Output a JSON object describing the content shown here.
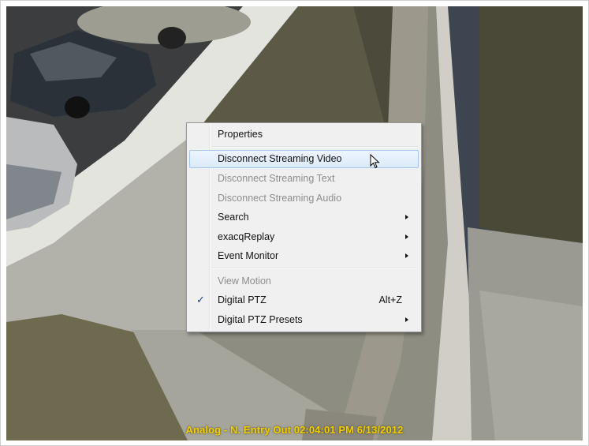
{
  "camera_overlay": "Analog - N. Entry Out 02:04:01 PM 6/13/2012",
  "menu": {
    "properties": "Properties",
    "disconnect_video": "Disconnect Streaming Video",
    "disconnect_text": "Disconnect Streaming Text",
    "disconnect_audio": "Disconnect Streaming Audio",
    "search": "Search",
    "exacq_replay": "exacqReplay",
    "event_monitor": "Event Monitor",
    "view_motion": "View Motion",
    "digital_ptz": "Digital PTZ",
    "digital_ptz_shortcut": "Alt+Z",
    "digital_ptz_checked": true,
    "digital_ptz_presets": "Digital PTZ Presets"
  },
  "colors": {
    "overlay_text": "#f2d000",
    "menu_background": "#f0f0f0",
    "hover_border": "#a6c7ea",
    "disabled_text": "#8d8d8d"
  }
}
